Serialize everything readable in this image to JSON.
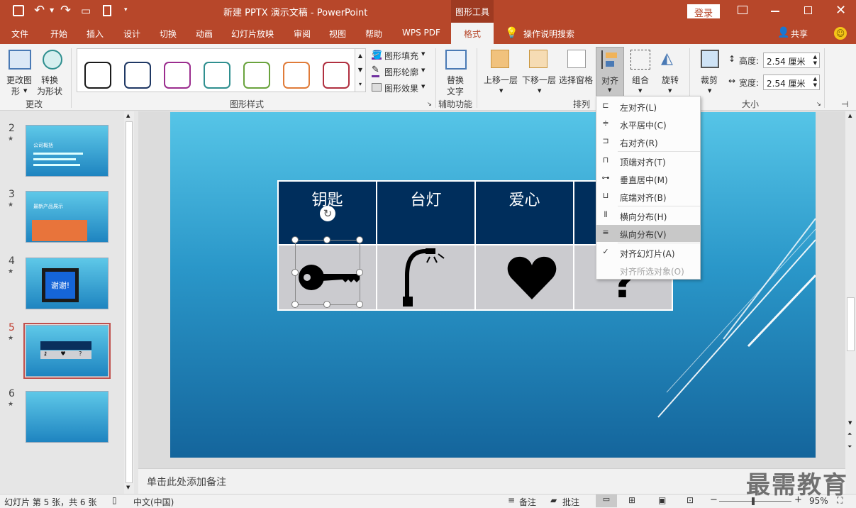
{
  "titlebar": {
    "doc_title": "新建 PPTX 演示文稿  -  PowerPoint",
    "context_tool": "图形工具",
    "login": "登录"
  },
  "tabs": [
    "文件",
    "开始",
    "插入",
    "设计",
    "切换",
    "动画",
    "幻灯片放映",
    "审阅",
    "视图",
    "帮助",
    "WPS PDF",
    "格式"
  ],
  "active_tab": "格式",
  "tell_me": "操作说明搜索",
  "share": "共享",
  "ribbon": {
    "change_shape": [
      "更改图",
      "形"
    ],
    "convert": [
      "转换",
      "为形状"
    ],
    "group_change": "更改",
    "shape_fill": "图形填充",
    "shape_outline": "图形轮廓",
    "shape_effects": "图形效果",
    "group_styles": "图形样式",
    "alt_text": [
      "替换",
      "文字"
    ],
    "group_access": "辅助功能",
    "bring_forward": "上移一层",
    "send_backward": "下移一层",
    "selection_pane": "选择窗格",
    "align": "对齐",
    "group_btn": "组合",
    "rotate": "旋转",
    "group_arrange": "排列",
    "crop": "裁剪",
    "height_label": "高度:",
    "height_value": "2.54 厘米",
    "width_label": "宽度:",
    "width_value": "2.54 厘米",
    "group_size": "大小",
    "swatch_colors": [
      "#1a1a1a",
      "#1f3864",
      "#9b2d8e",
      "#2f8f8f",
      "#6aa33d",
      "#e07b39",
      "#b03040"
    ]
  },
  "thumbnails": [
    {
      "num": "2",
      "star": "★",
      "label": "公司概括"
    },
    {
      "num": "3",
      "star": "★",
      "label": "最新产品展示"
    },
    {
      "num": "4",
      "star": "★",
      "label": "谢谢!"
    },
    {
      "num": "5",
      "star": "★"
    },
    {
      "num": "6",
      "star": "★"
    }
  ],
  "slide_table": {
    "headers": [
      "钥匙",
      "台灯",
      "爱心",
      ""
    ]
  },
  "align_menu": {
    "items": [
      {
        "label": "左对齐(L)"
      },
      {
        "label": "水平居中(C)"
      },
      {
        "label": "右对齐(R)"
      },
      {
        "label": "顶端对齐(T)"
      },
      {
        "label": "垂直居中(M)"
      },
      {
        "label": "底端对齐(B)"
      },
      {
        "label": "横向分布(H)"
      },
      {
        "label": "纵向分布(V)"
      },
      {
        "label": "对齐幻灯片(A)",
        "check": "✓"
      },
      {
        "label": "对齐所选对象(O)"
      }
    ]
  },
  "notes_placeholder": "单击此处添加备注",
  "status": {
    "slide_info": "幻灯片 第 5 张，共 6 张",
    "language": "中文(中国)",
    "notes": "备注",
    "comments": "批注",
    "zoom": "95%"
  },
  "watermark": "最需教育"
}
